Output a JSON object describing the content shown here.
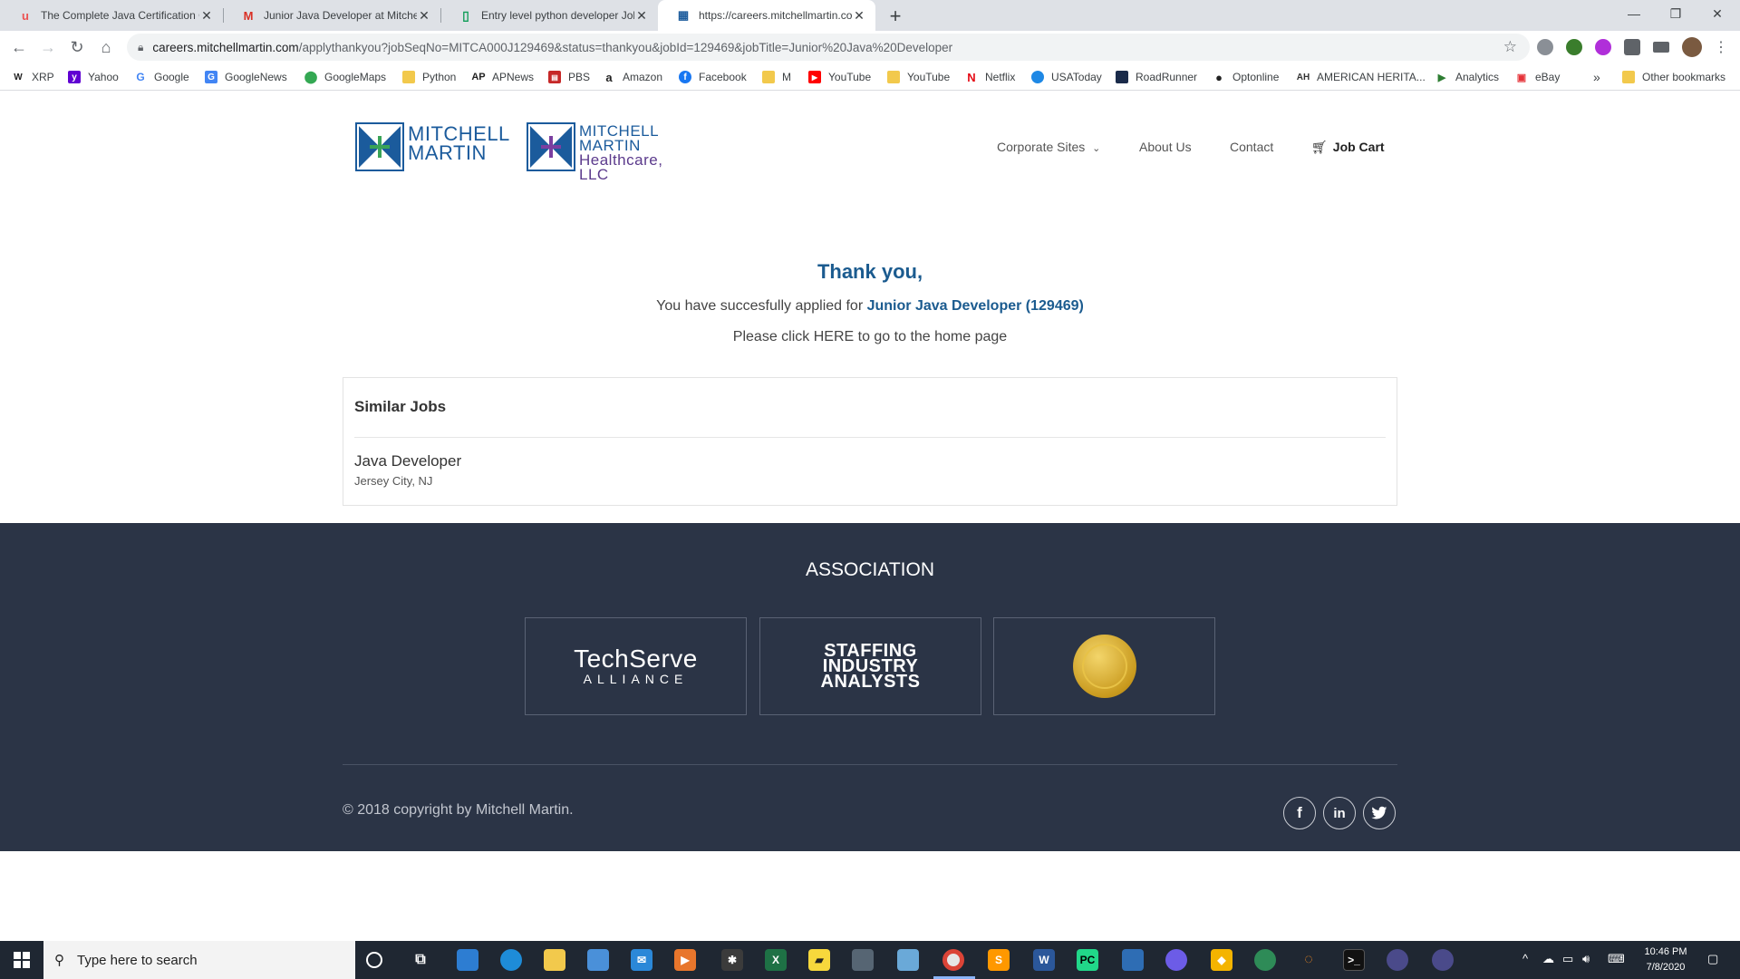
{
  "browser": {
    "tabs": [
      {
        "title": "The Complete Java Certification C",
        "icon": "udemy-icon",
        "color": "#ec5252",
        "glyph": "u"
      },
      {
        "title": "Junior Java Developer at Mitchell",
        "icon": "gmail-icon",
        "color": "#d93025",
        "glyph": "M"
      },
      {
        "title": "Entry level python developer Job",
        "icon": "sheets-icon",
        "color": "#0f9d58",
        "glyph": "▯"
      },
      {
        "title": "https://careers.mitchellmartin.co",
        "icon": "site-icon",
        "color": "#1b5b9c",
        "glyph": "▦"
      }
    ],
    "url_host": "careers.mitchellmartin.com",
    "url_path": "/applythankyou?jobSeqNo=MITCA000J129469&status=thankyou&jobId=129469&jobTitle=Junior%20Java%20Developer",
    "bookmarks": [
      {
        "label": "XRP",
        "icon": "xrp-icon",
        "color": "#222"
      },
      {
        "label": "Yahoo",
        "icon": "yahoo-icon",
        "color": "#6001d2"
      },
      {
        "label": "Google",
        "icon": "google-icon",
        "color": "#4285f4"
      },
      {
        "label": "GoogleNews",
        "icon": "googlenews-icon",
        "color": "#4285f4"
      },
      {
        "label": "GoogleMaps",
        "icon": "googlemaps-icon",
        "color": "#34a853"
      },
      {
        "label": "Python",
        "icon": "folder-icon",
        "color": "#f2c94c"
      },
      {
        "label": "APNews",
        "icon": "apnews-icon",
        "color": "#222"
      },
      {
        "label": "PBS",
        "icon": "pbs-icon",
        "color": "#c62828"
      },
      {
        "label": "Amazon",
        "icon": "amazon-icon",
        "color": "#222"
      },
      {
        "label": "Facebook",
        "icon": "facebook-icon",
        "color": "#1877f2"
      },
      {
        "label": "M",
        "icon": "folder-icon",
        "color": "#f2c94c"
      },
      {
        "label": "YouTube",
        "icon": "youtube-icon",
        "color": "#ff0000"
      },
      {
        "label": "YouTube",
        "icon": "folder-icon",
        "color": "#f2c94c"
      },
      {
        "label": "Netflix",
        "icon": "netflix-icon",
        "color": "#e50914"
      },
      {
        "label": "USAToday",
        "icon": "usatoday-icon",
        "color": "#1e88e5"
      },
      {
        "label": "RoadRunner",
        "icon": "roadrunner-icon",
        "color": "#1a2b4a"
      },
      {
        "label": "Optonline",
        "icon": "optonline-icon",
        "color": "#222"
      },
      {
        "label": "AMERICAN HERITA...",
        "icon": "americanheritage-icon",
        "color": "#333"
      },
      {
        "label": "Analytics",
        "icon": "analytics-icon",
        "color": "#2e7d32"
      },
      {
        "label": "eBay",
        "icon": "ebay-icon",
        "color": "#e53238"
      }
    ],
    "more_bookmarks": "»",
    "other_bookmarks": "Other bookmarks"
  },
  "site": {
    "logo1": {
      "line1": "MITCHELL",
      "line2": "MARTIN"
    },
    "logo2": {
      "line1": "MITCHELL",
      "line2": "MARTIN",
      "line3": "Healthcare, LLC"
    },
    "nav": {
      "corporate_sites": "Corporate Sites",
      "about": "About Us",
      "contact": "Contact",
      "job_cart": "Job Cart"
    },
    "thank_you": "Thank you,",
    "applied_prefix": "You have succesfully applied for",
    "applied_job": "Junior Java Developer (129469)",
    "home_link": "Please click HERE to go to the home page",
    "similar_jobs": {
      "heading": "Similar Jobs",
      "items": [
        {
          "title": "Java Developer",
          "location": "Jersey City, NJ"
        }
      ]
    },
    "footer": {
      "association_heading": "ASSOCIATION",
      "techserve_line1": "TechServe",
      "techserve_line2": "ALLIANCE",
      "sia_line1": "STAFFING",
      "sia_line2": "INDUSTRY",
      "sia_line3": "ANALYSTS",
      "copyright": "© 2018 copyright by Mitchell Martin.",
      "social": [
        {
          "name": "facebook-icon",
          "glyph": "f"
        },
        {
          "name": "linkedin-icon",
          "glyph": "in"
        },
        {
          "name": "twitter-icon",
          "glyph": "t"
        }
      ]
    },
    "brand_color": "#1b5b8f",
    "footer_bg": "#2b3446"
  },
  "taskbar": {
    "search_placeholder": "Type here to search",
    "time": "10:46 PM",
    "date": "7/8/2020"
  }
}
